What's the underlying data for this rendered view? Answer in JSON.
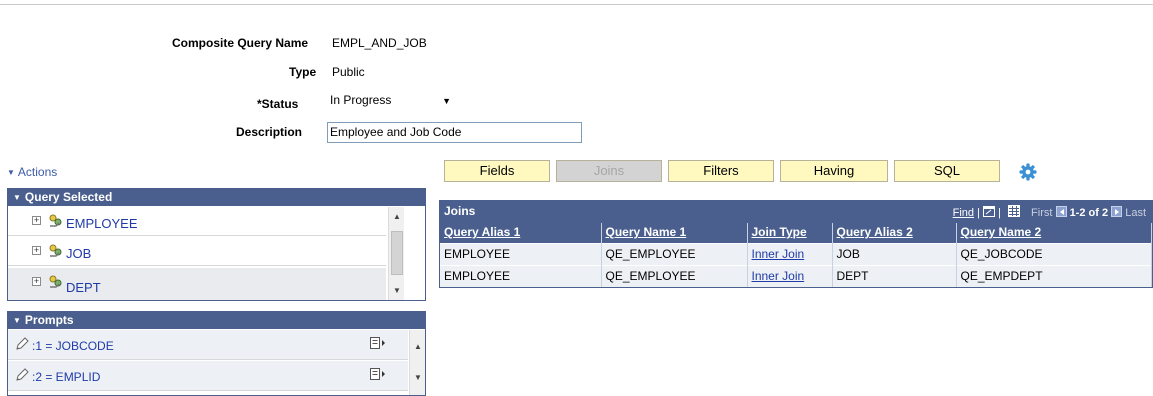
{
  "header": {
    "composite_query_name_label": "Composite Query Name",
    "composite_query_name": "EMPL_AND_JOB",
    "type_label": "Type",
    "type_value": "Public",
    "status_label": "*Status",
    "status_value": "In Progress",
    "description_label": "Description",
    "description_value": "Employee and Job Code"
  },
  "actions_label": "Actions",
  "query_selected": {
    "title": "Query Selected",
    "items": [
      {
        "label": "EMPLOYEE"
      },
      {
        "label": "JOB"
      },
      {
        "label": "DEPT"
      }
    ]
  },
  "prompts": {
    "title": "Prompts",
    "items": [
      {
        "label": ":1 = JOBCODE"
      },
      {
        "label": ":2 = EMPLID"
      }
    ]
  },
  "tabs": [
    {
      "label": "Fields",
      "enabled": true
    },
    {
      "label": "Joins",
      "enabled": false
    },
    {
      "label": "Filters",
      "enabled": true
    },
    {
      "label": "Having",
      "enabled": true
    },
    {
      "label": "SQL",
      "enabled": true
    }
  ],
  "joins_grid": {
    "title": "Joins",
    "find_label": "Find",
    "first_label": "First",
    "range_label": "1-2 of 2",
    "last_label": "Last",
    "columns": [
      "Query Alias 1",
      "Query Name 1",
      "Join Type",
      "Query Alias 2",
      "Query Name 2"
    ],
    "rows": [
      [
        "EMPLOYEE",
        "QE_EMPLOYEE",
        "Inner Join",
        "JOB",
        "QE_JOBCODE"
      ],
      [
        "EMPLOYEE",
        "QE_EMPLOYEE",
        "Inner Join",
        "DEPT",
        "QE_EMPDEPT"
      ]
    ]
  },
  "colors": {
    "grid_header": "#4a5f8d",
    "tab_active": "#fff9c0",
    "tab_disabled": "#d3d3d3",
    "link": "#1f3ba7"
  }
}
